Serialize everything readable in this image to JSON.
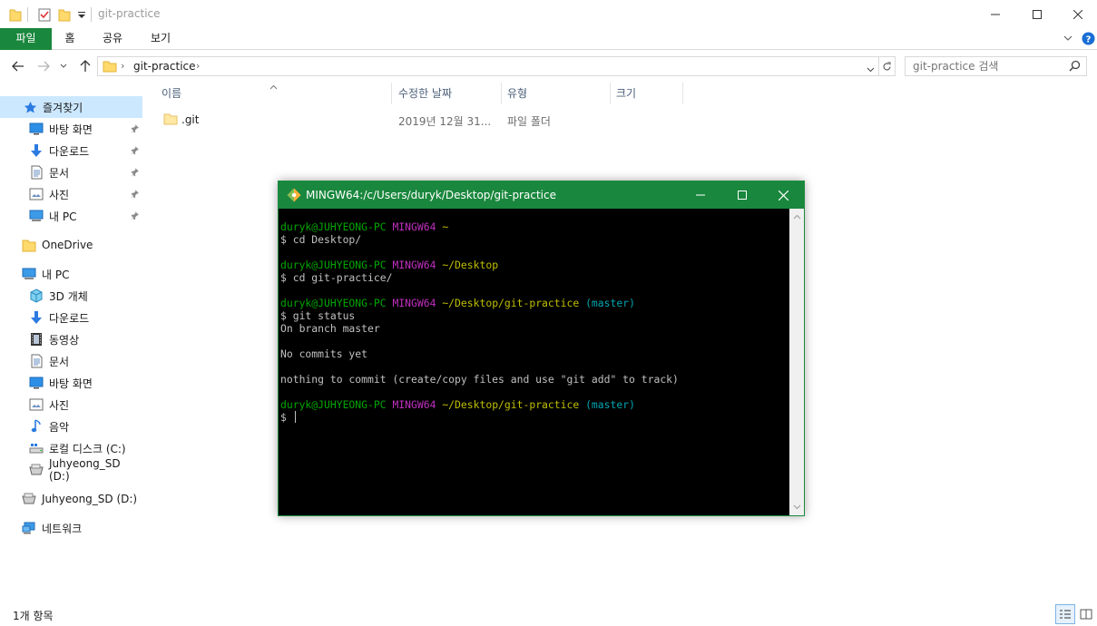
{
  "explorer": {
    "title": "git-practice",
    "ribbon_tabs": [
      "파일",
      "홈",
      "공유",
      "보기"
    ],
    "address": {
      "crumb": "git-practice"
    },
    "search": {
      "placeholder": "git-practice 검색"
    },
    "sidebar": {
      "quick_access": "즐겨찾기",
      "items": [
        {
          "label": "즐겨찾기",
          "icon": "star-icon"
        },
        {
          "label": "바탕 화면",
          "icon": "desktop-icon"
        },
        {
          "label": "다운로드",
          "icon": "download-icon"
        },
        {
          "label": "문서",
          "icon": "document-icon"
        },
        {
          "label": "사진",
          "icon": "picture-icon"
        },
        {
          "label": "내 PC",
          "icon": "computer-icon"
        },
        {
          "label": "OneDrive",
          "icon": "folder-icon"
        },
        {
          "label": "내 PC",
          "icon": "computer-icon"
        },
        {
          "label": "3D 개체",
          "icon": "cube-icon"
        },
        {
          "label": "다운로드",
          "icon": "download-icon"
        },
        {
          "label": "동영상",
          "icon": "video-icon"
        },
        {
          "label": "문서",
          "icon": "document-icon"
        },
        {
          "label": "바탕 화면",
          "icon": "desktop-icon"
        },
        {
          "label": "사진",
          "icon": "picture-icon"
        },
        {
          "label": "음악",
          "icon": "music-icon"
        },
        {
          "label": "로컬 디스크 (C:)",
          "icon": "drive-icon"
        },
        {
          "label": "Juhyeong_SD (D:)",
          "icon": "sd-card-icon"
        },
        {
          "label": "Juhyeong_SD (D:)",
          "icon": "sd-card-icon"
        },
        {
          "label": "네트워크",
          "icon": "network-icon"
        }
      ]
    },
    "columns": [
      "이름",
      "수정한 날짜",
      "유형",
      "크기"
    ],
    "files": [
      {
        "name": ".git",
        "modified": "2019년 12월 31...",
        "type": "파일 폴더",
        "size": ""
      }
    ],
    "status": {
      "count": "1개 항목"
    }
  },
  "terminal": {
    "title": "MINGW64:/c/Users/duryk/Desktop/git-practice",
    "lines": [
      {
        "user": "duryk@JUHYEONG-PC",
        "sys": "MINGW64",
        "path": "~",
        "branch": ""
      },
      {
        "cmd": "$ cd Desktop/"
      },
      {
        "blank": ""
      },
      {
        "user": "duryk@JUHYEONG-PC",
        "sys": "MINGW64",
        "path": "~/Desktop",
        "branch": ""
      },
      {
        "cmd": "$ cd git-practice/"
      },
      {
        "blank": ""
      },
      {
        "user": "duryk@JUHYEONG-PC",
        "sys": "MINGW64",
        "path": "~/Desktop/git-practice",
        "branch": "(master)"
      },
      {
        "cmd": "$ git status"
      },
      {
        "out": "On branch master"
      },
      {
        "blank": ""
      },
      {
        "out": "No commits yet"
      },
      {
        "blank": ""
      },
      {
        "out": "nothing to commit (create/copy files and use \"git add\" to track)"
      },
      {
        "blank": ""
      },
      {
        "user": "duryk@JUHYEONG-PC",
        "sys": "MINGW64",
        "path": "~/Desktop/git-practice",
        "branch": "(master)"
      },
      {
        "cmd": "$ "
      }
    ],
    "colors": {
      "titlebar": "#19873d",
      "user": "#00a600",
      "sys": "#bf2fbf",
      "path": "#bfbf00",
      "branch": "#00a6b2",
      "text": "#c0c0c0"
    }
  }
}
